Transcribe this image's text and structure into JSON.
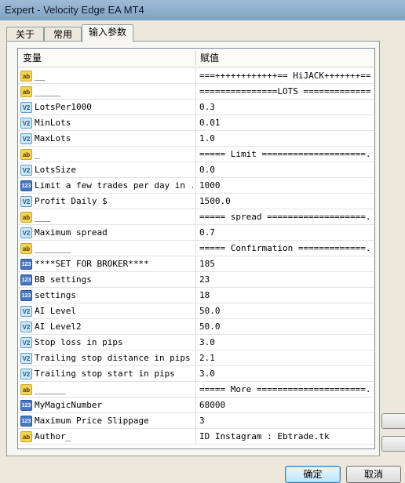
{
  "window": {
    "title": "Expert - Velocity Edge EA MT4"
  },
  "tabs": [
    {
      "label": "关于",
      "active": false
    },
    {
      "label": "常用",
      "active": false
    },
    {
      "label": "输入参数",
      "active": true
    }
  ],
  "table": {
    "headers": {
      "variable": "变量",
      "value": "赋值"
    },
    "rows": [
      {
        "icon": "ab",
        "name": "__",
        "value": "===++++++++++++== HiJACK+++++++===..."
      },
      {
        "icon": "ab",
        "name": "_____",
        "value": "===============LOTS =============..."
      },
      {
        "icon": "v2",
        "name": "LotsPer1000",
        "value": "0.3"
      },
      {
        "icon": "v2",
        "name": "MinLots",
        "value": "0.01"
      },
      {
        "icon": "v2",
        "name": "MaxLots",
        "value": "1.0"
      },
      {
        "icon": "ab",
        "name": "_",
        "value": "===== Limit ====================..."
      },
      {
        "icon": "v2",
        "name": "LotsSize",
        "value": "0.0"
      },
      {
        "icon": "123",
        "name": "Limit a few trades per day in ...",
        "value": "1000"
      },
      {
        "icon": "v2",
        "name": "Profit Daily $",
        "value": "1500.0"
      },
      {
        "icon": "ab",
        "name": "___",
        "value": "===== spread ===================..."
      },
      {
        "icon": "v2",
        "name": "Maximum spread",
        "value": "0.7"
      },
      {
        "icon": "ab",
        "name": "_______",
        "value": "===== Confirmation =============..."
      },
      {
        "icon": "123",
        "name": "****SET FOR BROKER****",
        "value": "185"
      },
      {
        "icon": "123",
        "name": "BB settings",
        "value": "23"
      },
      {
        "icon": "123",
        "name": "settings",
        "value": "18"
      },
      {
        "icon": "v2",
        "name": "AI Level",
        "value": "50.0"
      },
      {
        "icon": "v2",
        "name": "AI Level2",
        "value": "50.0"
      },
      {
        "icon": "v2",
        "name": "Stop loss in pips",
        "value": "3.0"
      },
      {
        "icon": "v2",
        "name": "Trailing stop distance in pips",
        "value": "2.1"
      },
      {
        "icon": "v2",
        "name": "Trailing stop start in pips",
        "value": "3.0"
      },
      {
        "icon": "ab",
        "name": "______",
        "value": "===== More =====================..."
      },
      {
        "icon": "123",
        "name": "MyMagicNumber",
        "value": "68000"
      },
      {
        "icon": "123",
        "name": "Maximum Price Slippage",
        "value": "3"
      },
      {
        "icon": "ab",
        "name": "Author_",
        "value": "ID Instagram : Ebtrade.tk"
      }
    ]
  },
  "buttons": {
    "ok": "确定",
    "cancel": "取消"
  }
}
